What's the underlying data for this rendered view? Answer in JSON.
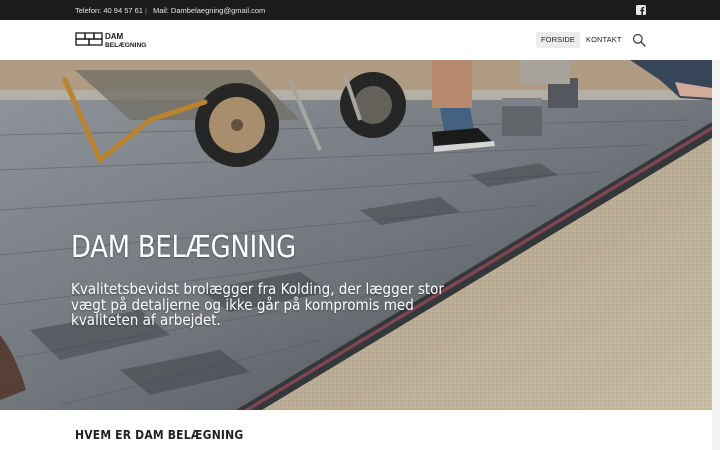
{
  "topbar": {
    "phone": "Telefon: 40 94 57 61",
    "separator": "|",
    "mail": "Mail: Dambelaegning@gmail.com",
    "social_icon": "facebook-icon"
  },
  "header": {
    "logo_line1": "DAM",
    "logo_line2": "BELÆGNING",
    "nav": [
      {
        "label": "FORSIDE",
        "active": true
      },
      {
        "label": "KONTAKT",
        "active": false
      }
    ],
    "search_icon": "search-icon"
  },
  "hero": {
    "title": "DAM BELÆGNING",
    "text": "Kvalitetsbevidst brolægger fra Kolding, der lægger stor vægt på detaljerne og ikke går på kompromis med kvaliteten af arbejdet."
  },
  "section": {
    "title": "HVEM ER DAM BELÆGNING"
  },
  "colors": {
    "topbar_bg": "#1c1c1c",
    "active_nav_bg": "#ececec",
    "text": "#222222"
  }
}
